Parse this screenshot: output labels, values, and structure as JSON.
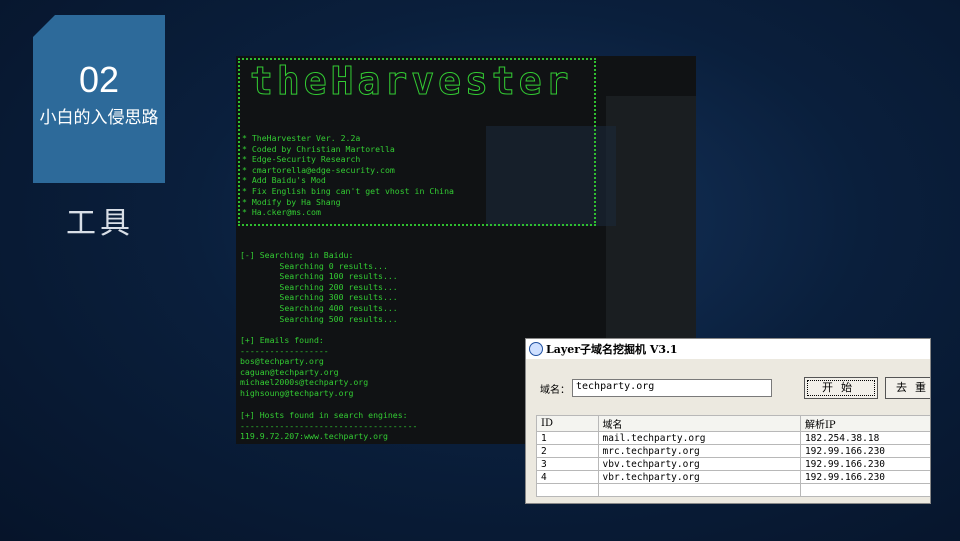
{
  "slide": {
    "number": "02",
    "subtitle": "小白的入侵思路",
    "section": "工具"
  },
  "terminal": {
    "banner": "theHarvester",
    "credits": [
      "* TheHarvester Ver. 2.2a",
      "* Coded by Christian Martorella",
      "* Edge-Security Research",
      "* cmartorella@edge-security.com",
      "* Add Baidu's Mod",
      "* Fix English bing can't get vhost in China",
      "* Modify by Ha Shang",
      "* Ha.cker@ms.com"
    ],
    "search": [
      "[-] Searching in Baidu:",
      "        Searching 0 results...",
      "        Searching 100 results...",
      "        Searching 200 results...",
      "        Searching 300 results...",
      "        Searching 400 results...",
      "        Searching 500 results..."
    ],
    "emails": [
      "[+] Emails found:",
      "------------------",
      "bos@techparty.org",
      "caguan@techparty.org",
      "michael2000s@techparty.org",
      "highsoung@techparty.org"
    ],
    "hosts": [
      "[+] Hosts found in search engines:",
      "------------------------------------",
      "119.9.72.207:www.techparty.org"
    ]
  },
  "layer": {
    "title": "Layer子域名挖掘机 V3.1",
    "domain_label": "域名：",
    "domain_value": "techparty.org",
    "start_label": "开始",
    "remove_label": "去重",
    "columns": [
      "ID",
      "域名",
      "解析IP"
    ],
    "rows": [
      [
        "1",
        "mail.techparty.org",
        "182.254.38.18"
      ],
      [
        "2",
        "mrc.techparty.org",
        "192.99.166.230"
      ],
      [
        "3",
        "vbv.techparty.org",
        "192.99.166.230"
      ],
      [
        "4",
        "vbr.techparty.org",
        "192.99.166.230"
      ]
    ]
  }
}
